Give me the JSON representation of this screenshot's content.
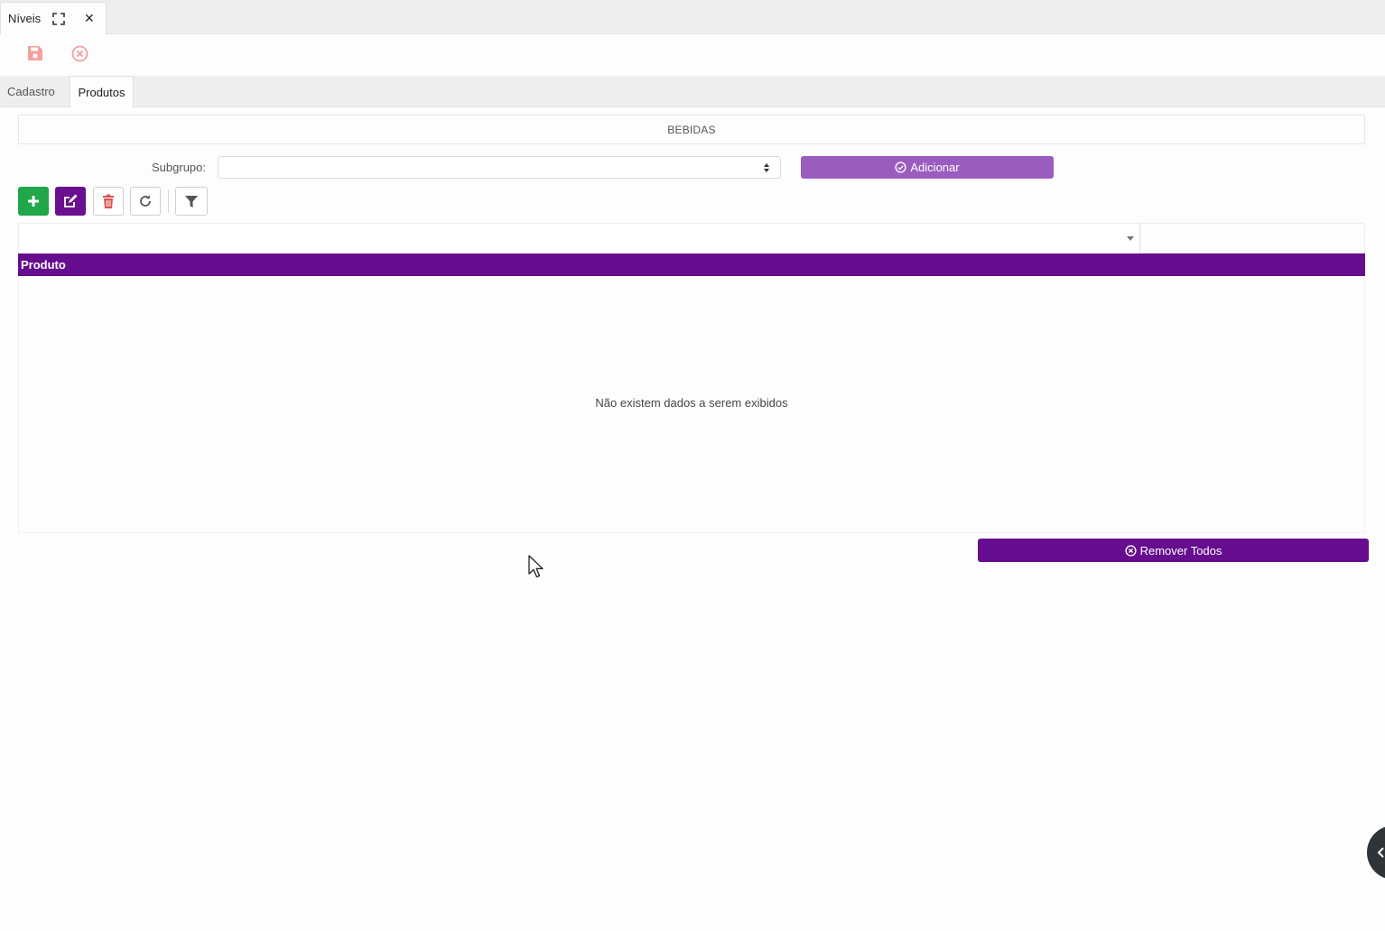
{
  "window_tab": {
    "label": "Níveis",
    "expand_icon": "expand-icon",
    "close_icon": "close-icon",
    "close_glyph": "✕"
  },
  "action_bar": {
    "save_icon": "save-icon",
    "cancel_icon": "cancel-icon",
    "icon_color": "#f4a0a0"
  },
  "page_tabs": [
    {
      "label": "Cadastro",
      "active": false
    },
    {
      "label": "Produtos",
      "active": true
    }
  ],
  "group": {
    "title": "BEBIDAS"
  },
  "subgrupo": {
    "label": "Subgrupo:",
    "value": ""
  },
  "add_button": {
    "label": "Adicionar",
    "icon": "check-circle-icon",
    "color": "#9b5cc0"
  },
  "toolbar": {
    "add_icon": "plus-icon",
    "edit_icon": "edit-icon",
    "delete_icon": "trash-icon",
    "refresh_icon": "refresh-icon",
    "filter_icon": "filter-icon"
  },
  "grid": {
    "columns": [
      {
        "label": "Produto"
      }
    ],
    "rows": [],
    "empty_message": "Não existem dados a serem exibidos",
    "header_color": "#650d8e"
  },
  "remove_all_button": {
    "label": "Remover Todos",
    "icon": "x-circle-icon",
    "color": "#650d8e"
  }
}
